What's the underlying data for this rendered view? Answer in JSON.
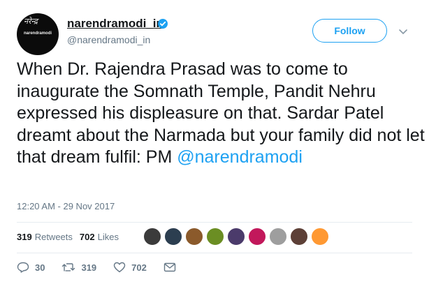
{
  "author": {
    "display_name": "narendramodi_in",
    "handle": "@narendramodi_in",
    "verified": true,
    "avatar_tag": "narendramodi",
    "avatar_signature": "नरेन्द्र"
  },
  "follow_label": "Follow",
  "tweet": {
    "text": "When Dr. Rajendra Prasad was to come to inaugurate the Somnath Temple, Pandit Nehru expressed his displeasure on that. Sardar Patel dreamt about the Narmada but your family did not let that dream fulfil: PM ",
    "mention": "@narendramodi",
    "timestamp": "12:20 AM - 29 Nov 2017"
  },
  "stats": {
    "retweets_count": "319",
    "retweets_label": "Retweets",
    "likes_count": "702",
    "likes_label": "Likes"
  },
  "liker_colors": [
    "#3b3b3b",
    "#2c3e50",
    "#8b5a2b",
    "#6b8e23",
    "#4b3b6b",
    "#c2185b",
    "#9e9e9e",
    "#5d4037",
    "#ff9933"
  ],
  "actions": {
    "replies": "30",
    "retweets": "319",
    "likes": "702"
  },
  "colors": {
    "accent": "#1da1f2",
    "text": "#14171a",
    "muted": "#657786"
  }
}
